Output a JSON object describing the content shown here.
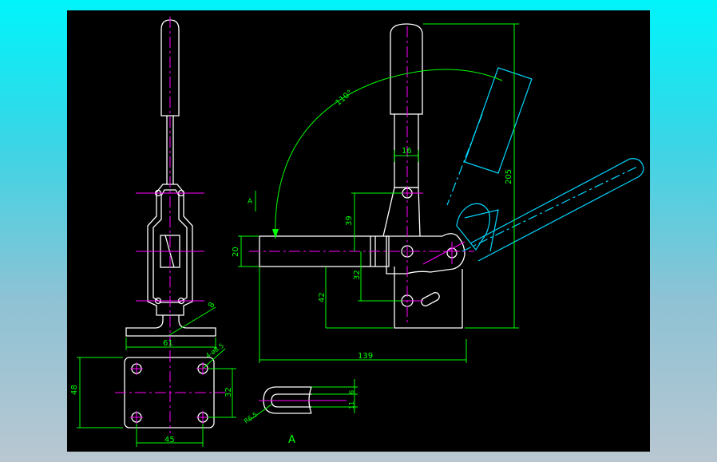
{
  "colors": {
    "background": "#000000",
    "outline": "#ffffff",
    "centerline": "#ff00ff",
    "dimension": "#00ff00",
    "alternate_position": "#00d8ff"
  },
  "dimensions": {
    "angle": "110°",
    "d16": "16",
    "d205": "205",
    "d39": "39",
    "d20": "20",
    "d32_side": "32",
    "d42": "42",
    "d139": "139",
    "d8": "8",
    "d61": "61",
    "hole": "4-ø8.5",
    "d48": "48",
    "d32_base": "32",
    "d45": "45",
    "d11": "11",
    "d6": "6",
    "r65": "R6.5"
  },
  "labels": {
    "view_arrow": "A",
    "view_title": "A"
  }
}
